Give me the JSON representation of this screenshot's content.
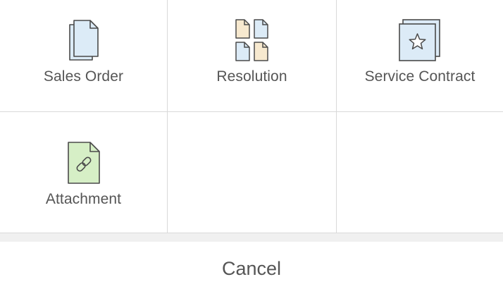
{
  "tiles": [
    {
      "label": "Sales Order",
      "icon": "document-stack-icon"
    },
    {
      "label": "Resolution",
      "icon": "multi-document-icon"
    },
    {
      "label": "Service Contract",
      "icon": "star-document-icon"
    },
    {
      "label": "Attachment",
      "icon": "link-document-icon"
    }
  ],
  "cancel_label": "Cancel",
  "colors": {
    "icon_stroke": "#4a4a4a",
    "doc_blue": "#dcebf7",
    "doc_peach": "#f7e9cf",
    "doc_green": "#d6efc6",
    "label_text": "#555555",
    "divider": "#d9d9d9",
    "separator_band": "#f0f0f0"
  }
}
